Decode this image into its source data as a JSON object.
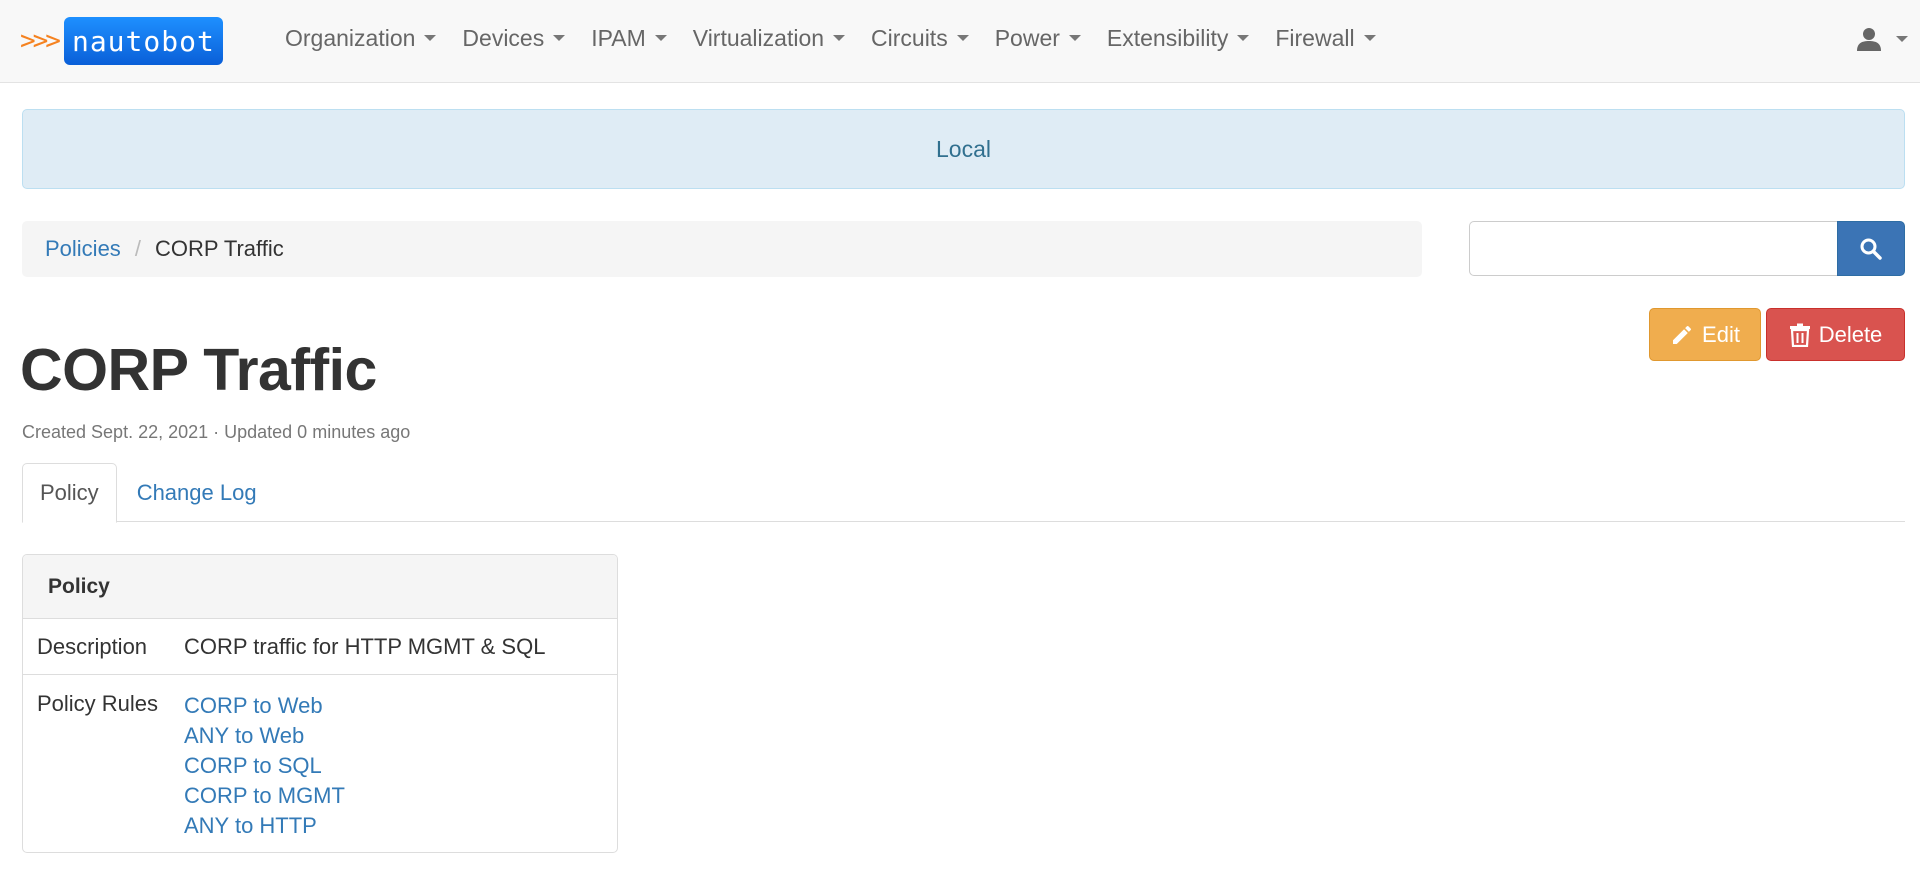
{
  "brand": {
    "arrows": ">>>",
    "name": "nautobot",
    "brand_color": "#1e90ff",
    "arrow_color": "#f58220"
  },
  "nav": {
    "items": [
      {
        "label": "Organization"
      },
      {
        "label": "Devices"
      },
      {
        "label": "IPAM"
      },
      {
        "label": "Virtualization"
      },
      {
        "label": "Circuits"
      },
      {
        "label": "Power"
      },
      {
        "label": "Extensibility"
      },
      {
        "label": "Firewall"
      }
    ],
    "user_icon": "user-icon"
  },
  "banner": {
    "text": "Local"
  },
  "breadcrumb": {
    "parent": "Policies",
    "current": "CORP Traffic"
  },
  "search": {
    "value": "",
    "placeholder": "",
    "icon": "search-icon"
  },
  "actions": {
    "edit_label": "Edit",
    "delete_label": "Delete",
    "edit_color": "#f0ad4e",
    "delete_color": "#d9534f"
  },
  "page": {
    "title": "CORP Traffic",
    "meta": "Created Sept. 22, 2021 · Updated 0 minutes ago"
  },
  "tabs": [
    {
      "label": "Policy",
      "active": true
    },
    {
      "label": "Change Log",
      "active": false
    }
  ],
  "panel": {
    "heading": "Policy",
    "description_label": "Description",
    "description_value": "CORP traffic for HTTP MGMT & SQL",
    "rules_label": "Policy Rules",
    "rules": [
      "CORP to Web",
      "ANY to Web",
      "CORP to SQL",
      "CORP to MGMT",
      "ANY to HTTP"
    ]
  }
}
